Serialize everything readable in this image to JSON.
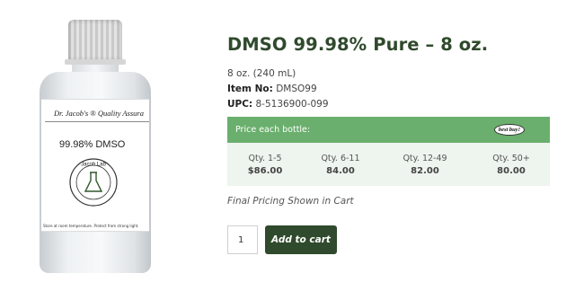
{
  "product": {
    "title": "DMSO 99.98% Pure – 8 oz.",
    "size": "8 oz. (240 mL)",
    "item_label": "Item No:",
    "item_value": "DMSO99",
    "upc_label": "UPC:",
    "upc_value": "8-5136900-099"
  },
  "image": {
    "label_brand": "Dr. Jacob's ® Quality Assura",
    "label_name": "99.98% DMSO",
    "logo_text": "Jacob Lab",
    "warning_text": "Store at room temperature. Protect from strong light."
  },
  "pricing": {
    "header": "Price each bottle:",
    "badge": "best buy!",
    "tiers": [
      {
        "qty": "Qty. 1-5",
        "price": "$86.00"
      },
      {
        "qty": "Qty. 6-11",
        "price": "84.00"
      },
      {
        "qty": "Qty. 12-49",
        "price": "82.00"
      },
      {
        "qty": "Qty. 50+",
        "price": "80.00"
      }
    ]
  },
  "note": "Final Pricing Shown in Cart",
  "cart": {
    "quantity": "1",
    "button_label": "Add to cart"
  },
  "colors": {
    "brand_dark_green": "#2f4a2c",
    "price_header_green": "#6aaf6d",
    "price_row_bg": "#eef4ee"
  }
}
